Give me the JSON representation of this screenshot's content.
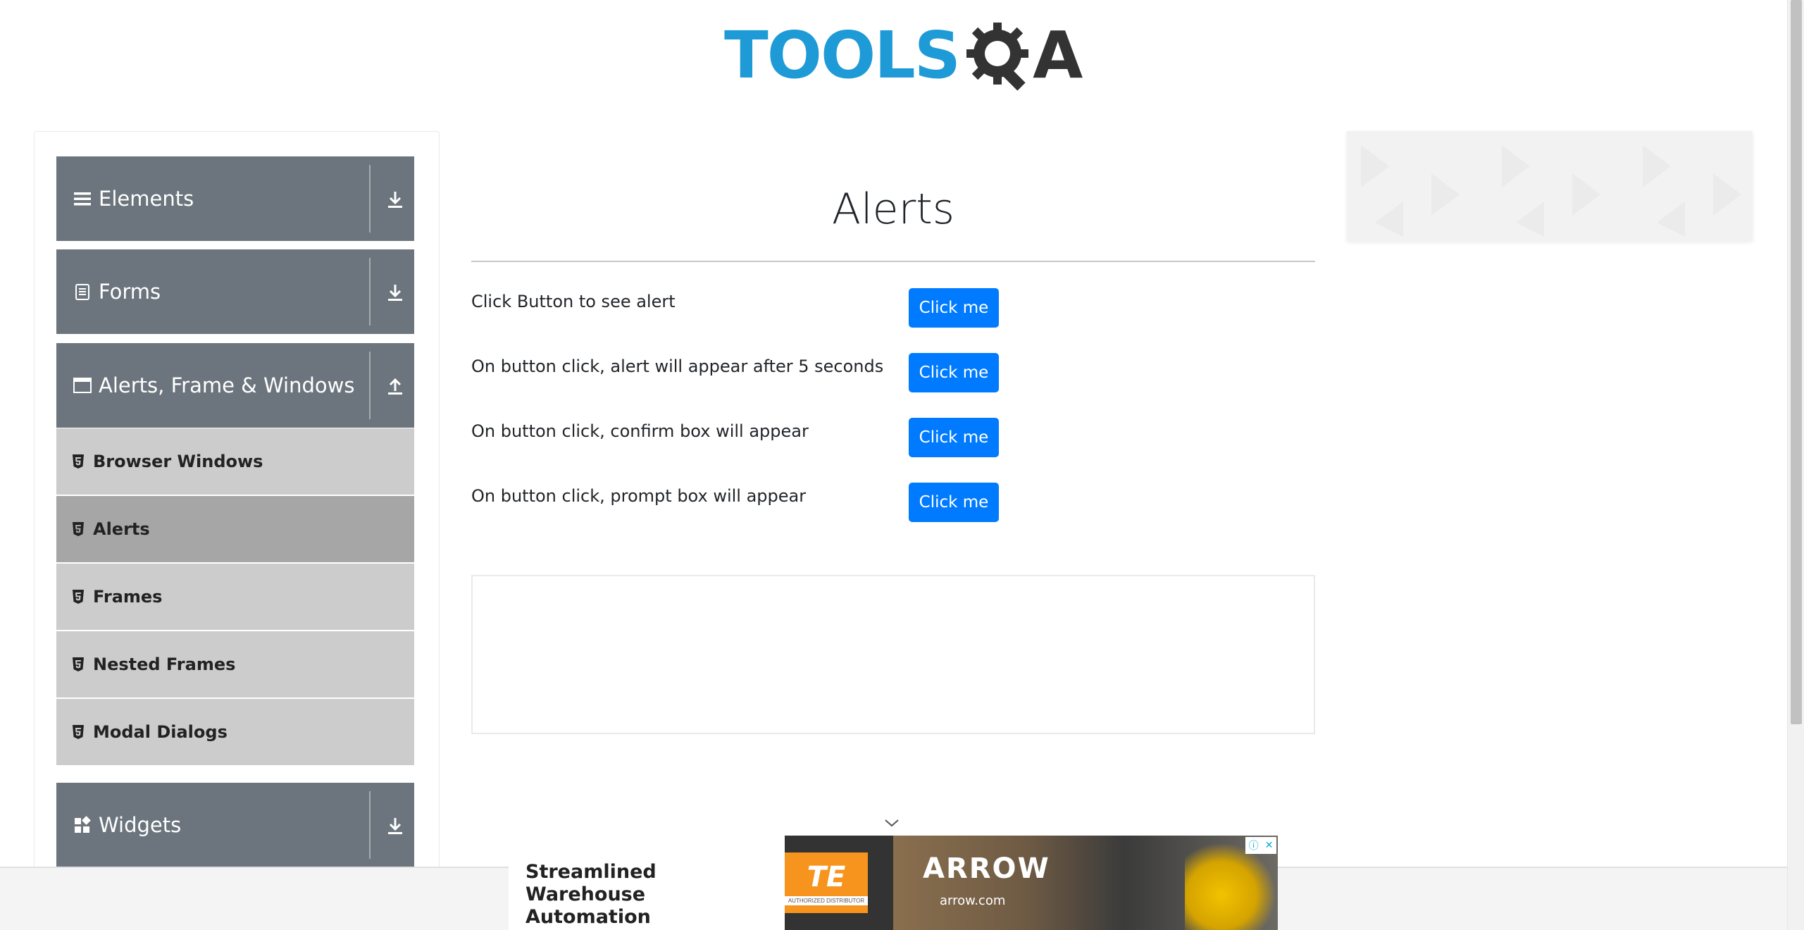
{
  "header": {
    "logo_text": "TOOLS",
    "logo_a": "A",
    "logo_alt": "TOOLSQA"
  },
  "sidebar": {
    "groups": [
      {
        "label": "Elements",
        "icon": "hamburger-icon",
        "arrow": "download-arrow-icon",
        "expanded": false
      },
      {
        "label": "Forms",
        "icon": "form-icon",
        "arrow": "download-arrow-icon",
        "expanded": false
      },
      {
        "label": "Alerts, Frame & Windows",
        "icon": "window-icon",
        "arrow": "upload-arrow-icon",
        "expanded": true
      },
      {
        "label": "Widgets",
        "icon": "widgets-icon",
        "arrow": "download-arrow-icon",
        "expanded": false
      }
    ],
    "items": [
      {
        "label": "Browser Windows",
        "active": false
      },
      {
        "label": "Alerts",
        "active": true
      },
      {
        "label": "Frames",
        "active": false
      },
      {
        "label": "Nested Frames",
        "active": false
      },
      {
        "label": "Modal Dialogs",
        "active": false
      }
    ]
  },
  "main": {
    "title": "Alerts",
    "rows": [
      {
        "label": "Click Button to see alert",
        "button": "Click me"
      },
      {
        "label": "On button click, alert will appear after 5 seconds",
        "button": "Click me"
      },
      {
        "label": "On button click, confirm box will appear",
        "button": "Click me"
      },
      {
        "label": "On button click, prompt box will appear",
        "button": "Click me"
      }
    ]
  },
  "banner_ad": {
    "headline_line1": "Streamlined Warehouse",
    "headline_line2": "Automation",
    "te_logo": "TE",
    "te_sub": "AUTHORIZED DISTRIBUTOR",
    "arrow_logo": "ARROW",
    "arrow_url": "arrow.com",
    "info_icon": "info-icon",
    "close_icon": "close-icon"
  },
  "colors": {
    "accent": "#007bff",
    "sidebar_header": "#6c757d",
    "sidebar_item": "#cccccc",
    "sidebar_item_active": "#a6a6a6",
    "logo_blue": "#1e9bd7"
  }
}
